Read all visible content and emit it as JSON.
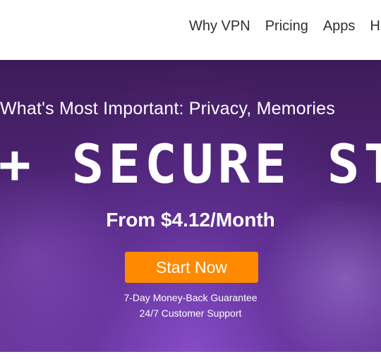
{
  "nav": {
    "items": [
      {
        "label": "Why VPN"
      },
      {
        "label": "Pricing"
      },
      {
        "label": "Apps"
      },
      {
        "label": "H"
      }
    ]
  },
  "hero": {
    "subhead": "What's Most Important: Privacy, Memories",
    "headline": "+ SECURE STO",
    "price": "From $4.12/Month",
    "cta_label": "Start Now",
    "guarantee": "7-Day Money-Back Guarantee",
    "support": "24/7 Customer Support"
  },
  "colors": {
    "cta": "#ff8a00",
    "hero_top": "#3e1c58",
    "hero_bottom": "#6b3aa0",
    "nav_text": "#2f2f2f"
  }
}
